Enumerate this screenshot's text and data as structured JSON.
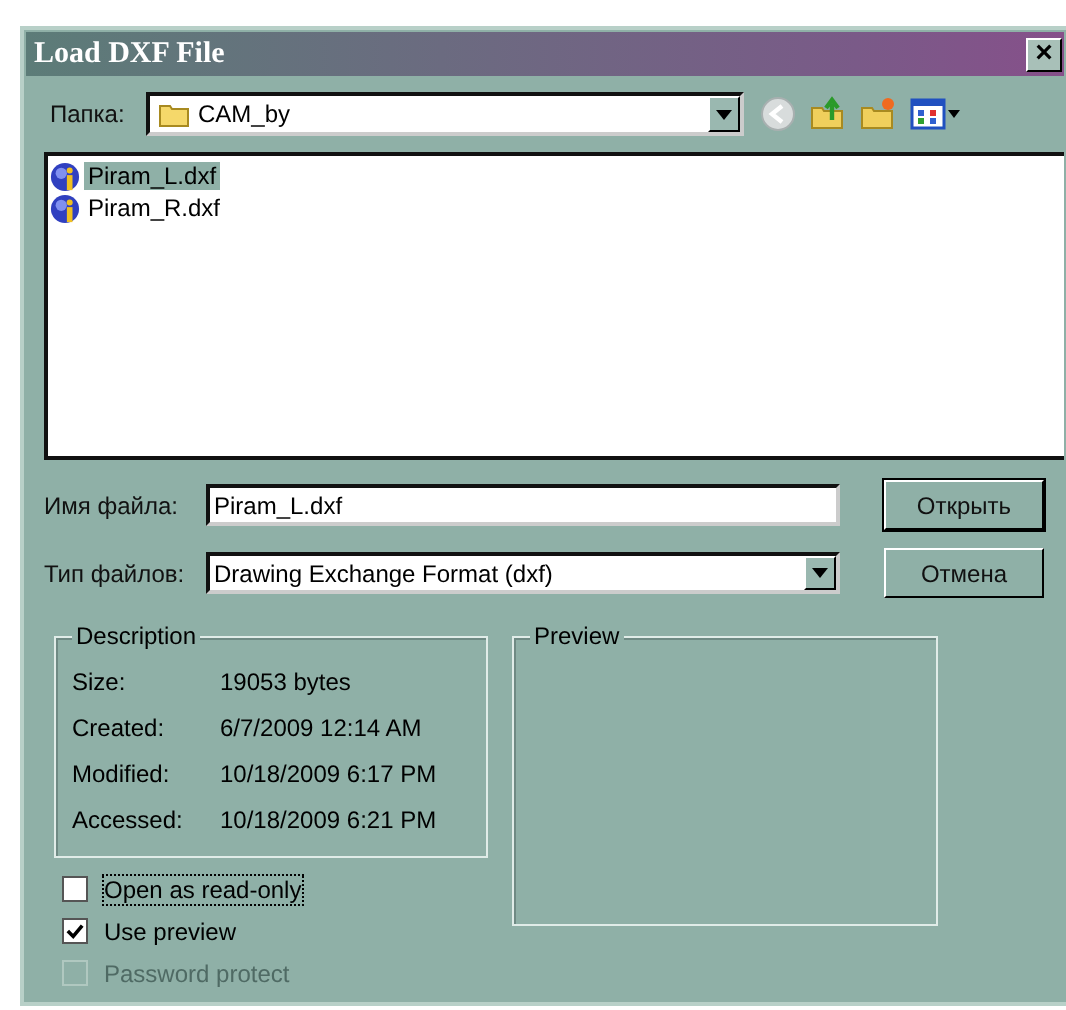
{
  "window": {
    "title": "Load DXF File",
    "close": "×"
  },
  "folder": {
    "label": "Папка:",
    "value": "CAM_by"
  },
  "files": [
    {
      "name": "Piram_L.dxf",
      "selected": true
    },
    {
      "name": "Piram_R.dxf",
      "selected": false
    }
  ],
  "file_name": {
    "label": "Имя файла:",
    "value": "Piram_L.dxf"
  },
  "file_type": {
    "label": "Тип файлов:",
    "value": "Drawing Exchange Format (dxf)"
  },
  "buttons": [
    "Открыть",
    "Отмена"
  ],
  "description": {
    "title": "Description",
    "rows": [
      {
        "label": "Size:",
        "value": "19053 bytes"
      },
      {
        "label": "Created:",
        "value": "6/7/2009 12:14 AM"
      },
      {
        "label": "Modified:",
        "value": "10/18/2009 6:17 PM"
      },
      {
        "label": "Accessed:",
        "value": "10/18/2009 6:21 PM"
      }
    ]
  },
  "preview": {
    "title": "Preview"
  },
  "options": [
    {
      "label": "Open as read-only",
      "checked": false,
      "disabled": false
    },
    {
      "label": "Use preview",
      "checked": true,
      "disabled": false
    },
    {
      "label": "Password protect",
      "checked": false,
      "disabled": true
    }
  ]
}
